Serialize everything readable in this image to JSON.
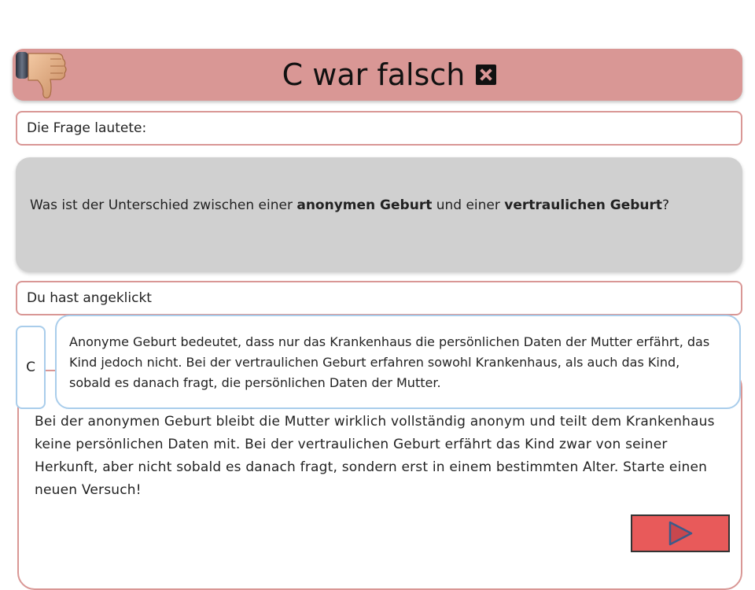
{
  "title": {
    "text": "C war falsch"
  },
  "question_label": "Die Frage lautete:",
  "question": {
    "part1": "Was ist der Unterschied zwischen einer ",
    "bold1": "anonymen Geburt",
    "part2": " und einer ",
    "bold2": "vertraulichen Geburt",
    "part3": "?"
  },
  "clicked_label": "Du hast angeklickt",
  "answer": {
    "letter": "C",
    "text": "Anonyme Geburt bedeutet, dass nur das Krankenhaus die persönlichen Daten der Mutter erfährt, das Kind jedoch nicht. Bei der vertraulichen Geburt erfahren sowohl Krankenhaus, als auch das Kind, sobald es danach fragt, die persönlichen Daten der Mutter."
  },
  "feedback": {
    "text": "Bei der anonymen Geburt bleibt die Mutter wirklich vollständig anonym und teilt dem Krankenhaus keine persönlichen Daten mit. Bei der vertraulichen Geburt erfährt das Kind zwar von seiner Herkunft, aber nicht sobald es danach fragt, sondern erst in einem bestimmten Alter. Starte einen neuen Versuch!"
  },
  "icons": {
    "thumb": "thumbs-down-icon",
    "x": "x-box-icon",
    "next": "play-arrow-icon"
  },
  "colors": {
    "title_bg": "#d99795",
    "question_bg": "#d0d0d0",
    "answer_border": "#a9cdeb",
    "next_btn": "#e85a5a"
  }
}
